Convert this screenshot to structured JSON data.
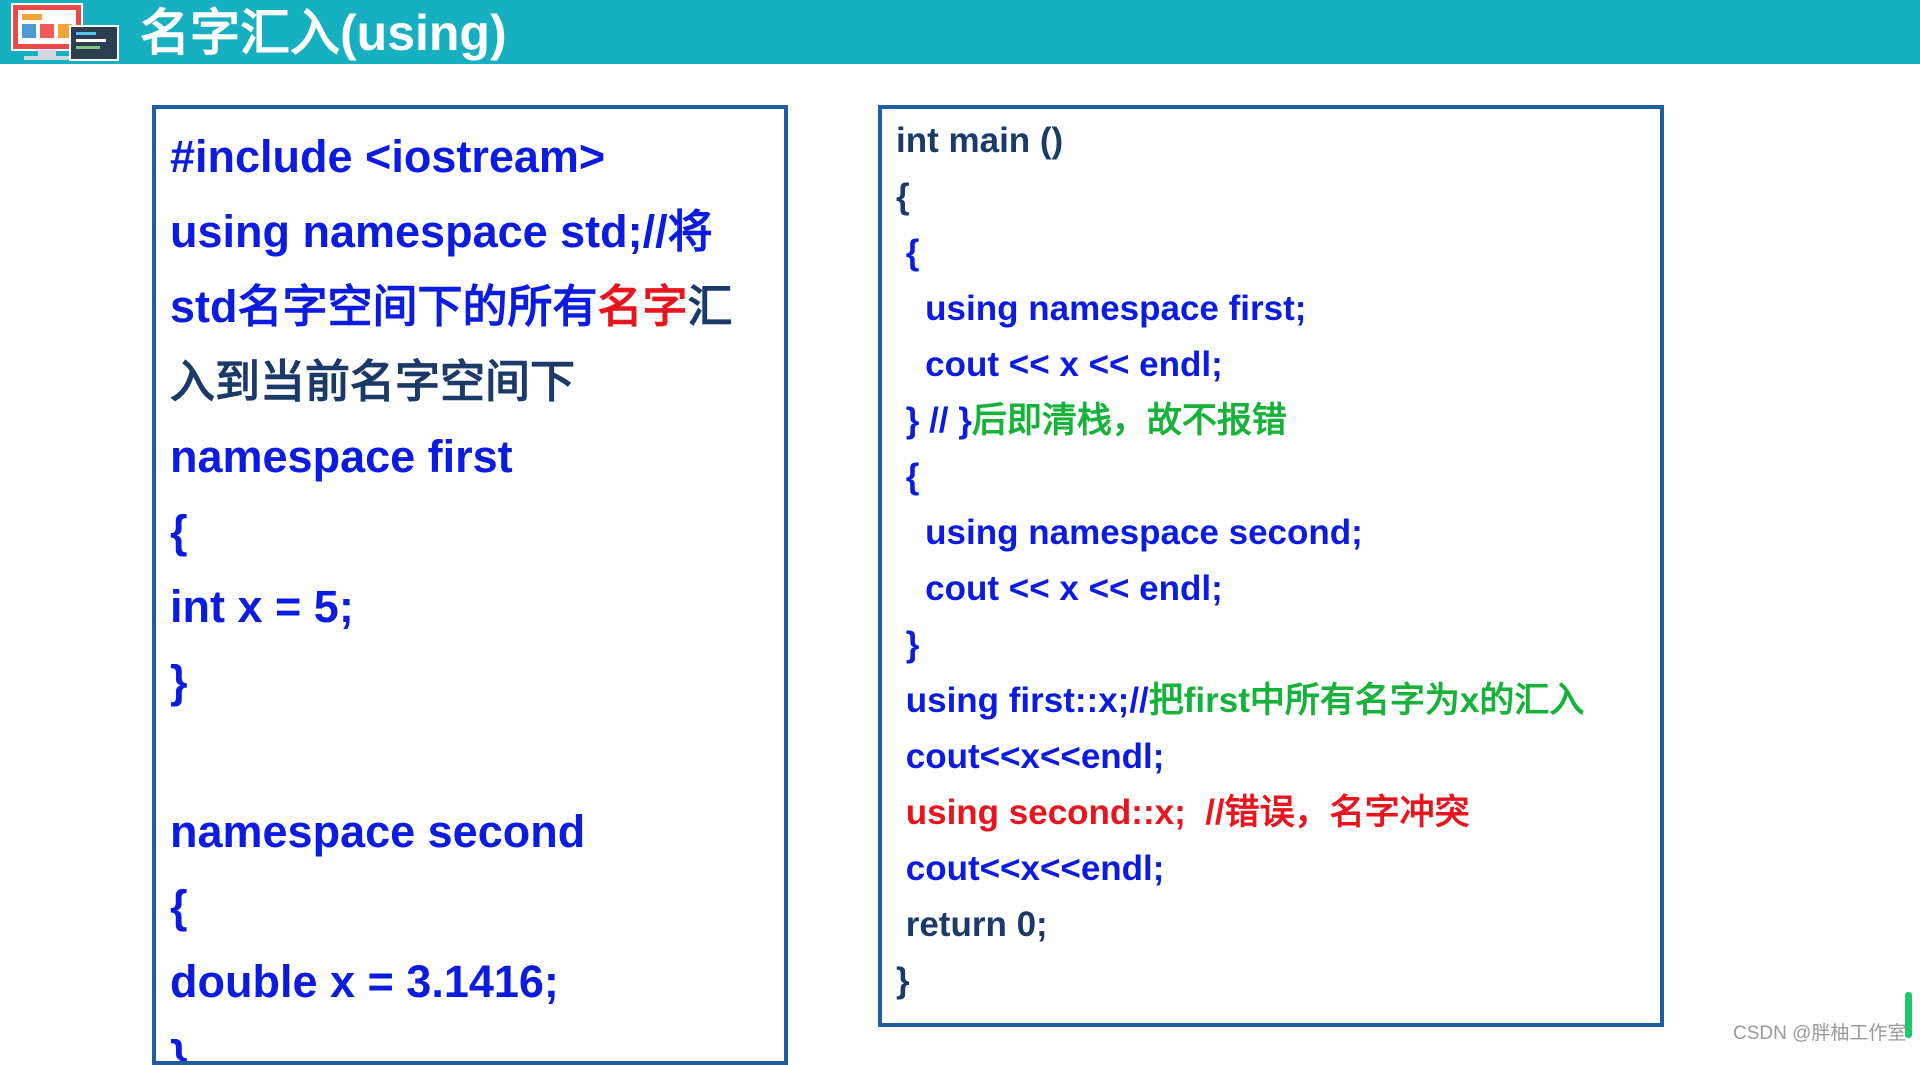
{
  "header": {
    "title": "名字汇入(using)",
    "bg_color": "#17b0c0",
    "logo_icon": "computer-monitor-illustration"
  },
  "left_code": [
    [
      {
        "text": "#include <iostream>",
        "color": "blue"
      }
    ],
    [
      {
        "text": "using namespace std;//将",
        "color": "blue"
      }
    ],
    [
      {
        "text": "std名字空间下的所有",
        "color": "blue"
      },
      {
        "text": "名字",
        "color": "red"
      },
      {
        "text": "汇",
        "color": "dark"
      }
    ],
    [
      {
        "text": "入到当前名字空间下",
        "color": "dark"
      }
    ],
    [
      {
        "text": "namespace first",
        "color": "blue"
      }
    ],
    [
      {
        "text": "{",
        "color": "blue"
      }
    ],
    [
      {
        "text": "  int x = 5;",
        "color": "blue"
      }
    ],
    [
      {
        "text": "}",
        "color": "blue"
      }
    ],
    [
      {
        "text": "",
        "color": "blue"
      }
    ],
    [
      {
        "text": "namespace second",
        "color": "blue"
      }
    ],
    [
      {
        "text": "{",
        "color": "blue"
      }
    ],
    [
      {
        "text": "  double x = 3.1416;",
        "color": "blue"
      }
    ],
    [
      {
        "text": "}",
        "color": "blue"
      }
    ]
  ],
  "right_code": [
    [
      {
        "text": "int main ()",
        "color": "darktext"
      }
    ],
    [
      {
        "text": "{",
        "color": "darktext"
      }
    ],
    [
      {
        "text": " {",
        "color": "blue"
      }
    ],
    [
      {
        "text": "   using namespace first;",
        "color": "blue"
      }
    ],
    [
      {
        "text": "   cout << x << endl;",
        "color": "blue"
      }
    ],
    [
      {
        "text": " } // }",
        "color": "blue"
      },
      {
        "text": "后即清栈，故不报错",
        "color": "green"
      }
    ],
    [
      {
        "text": " {",
        "color": "blue"
      }
    ],
    [
      {
        "text": "   using namespace second;",
        "color": "blue"
      }
    ],
    [
      {
        "text": "   cout << x << endl;",
        "color": "blue"
      }
    ],
    [
      {
        "text": " }",
        "color": "blue"
      }
    ],
    [
      {
        "text": " using first::x;//",
        "color": "blue"
      },
      {
        "text": "把first中所有名字为x的汇入",
        "color": "green"
      }
    ],
    [
      {
        "text": " cout<<x<<endl;",
        "color": "blue"
      }
    ],
    [
      {
        "text": " using second::x;  //错误，名字冲突",
        "color": "red"
      }
    ],
    [
      {
        "text": " cout<<x<<endl;",
        "color": "blue"
      }
    ],
    [
      {
        "text": " return 0;",
        "color": "darktext"
      }
    ],
    [
      {
        "text": "}",
        "color": "darktext"
      }
    ]
  ],
  "colors": {
    "blue": "#0b1ce0",
    "red": "#e8141e",
    "dark": "#1c3a68",
    "green": "#16b23a",
    "border": "#1f5fa0"
  },
  "watermark": "CSDN @胖柚工作室"
}
